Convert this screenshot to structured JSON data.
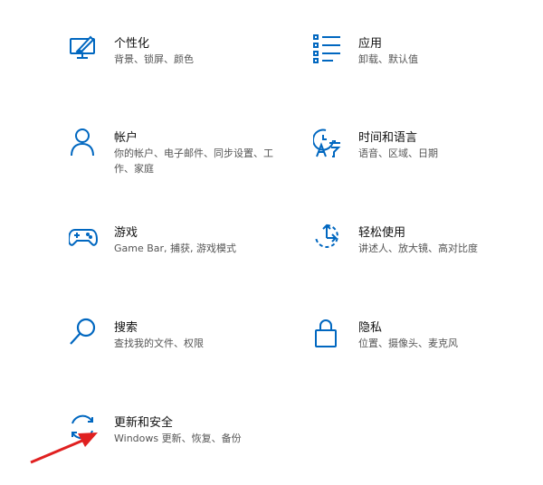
{
  "accent_color": "#0067c0",
  "settings": {
    "personalization": {
      "title": "个性化",
      "desc": "背景、锁屏、颜色",
      "icon": "personalization-icon"
    },
    "apps": {
      "title": "应用",
      "desc": "卸载、默认值",
      "icon": "apps-icon"
    },
    "accounts": {
      "title": "帐户",
      "desc": "你的帐户、电子邮件、同步设置、工作、家庭",
      "icon": "person-icon"
    },
    "time_language": {
      "title": "时间和语言",
      "desc": "语音、区域、日期",
      "icon": "time-language-icon"
    },
    "gaming": {
      "title": "游戏",
      "desc": "Game Bar, 捕获, 游戏模式",
      "icon": "gamepad-icon"
    },
    "ease_of_access": {
      "title": "轻松使用",
      "desc": "讲述人、放大镜、高对比度",
      "icon": "ease-of-access-icon"
    },
    "search": {
      "title": "搜索",
      "desc": "查找我的文件、权限",
      "icon": "search-icon"
    },
    "privacy": {
      "title": "隐私",
      "desc": "位置、摄像头、麦克风",
      "icon": "lock-icon"
    },
    "update_security": {
      "title": "更新和安全",
      "desc": "Windows 更新、恢复、备份",
      "icon": "sync-icon"
    }
  },
  "annotation": {
    "type": "arrow",
    "color": "#e02020",
    "points_to": "update_security"
  }
}
